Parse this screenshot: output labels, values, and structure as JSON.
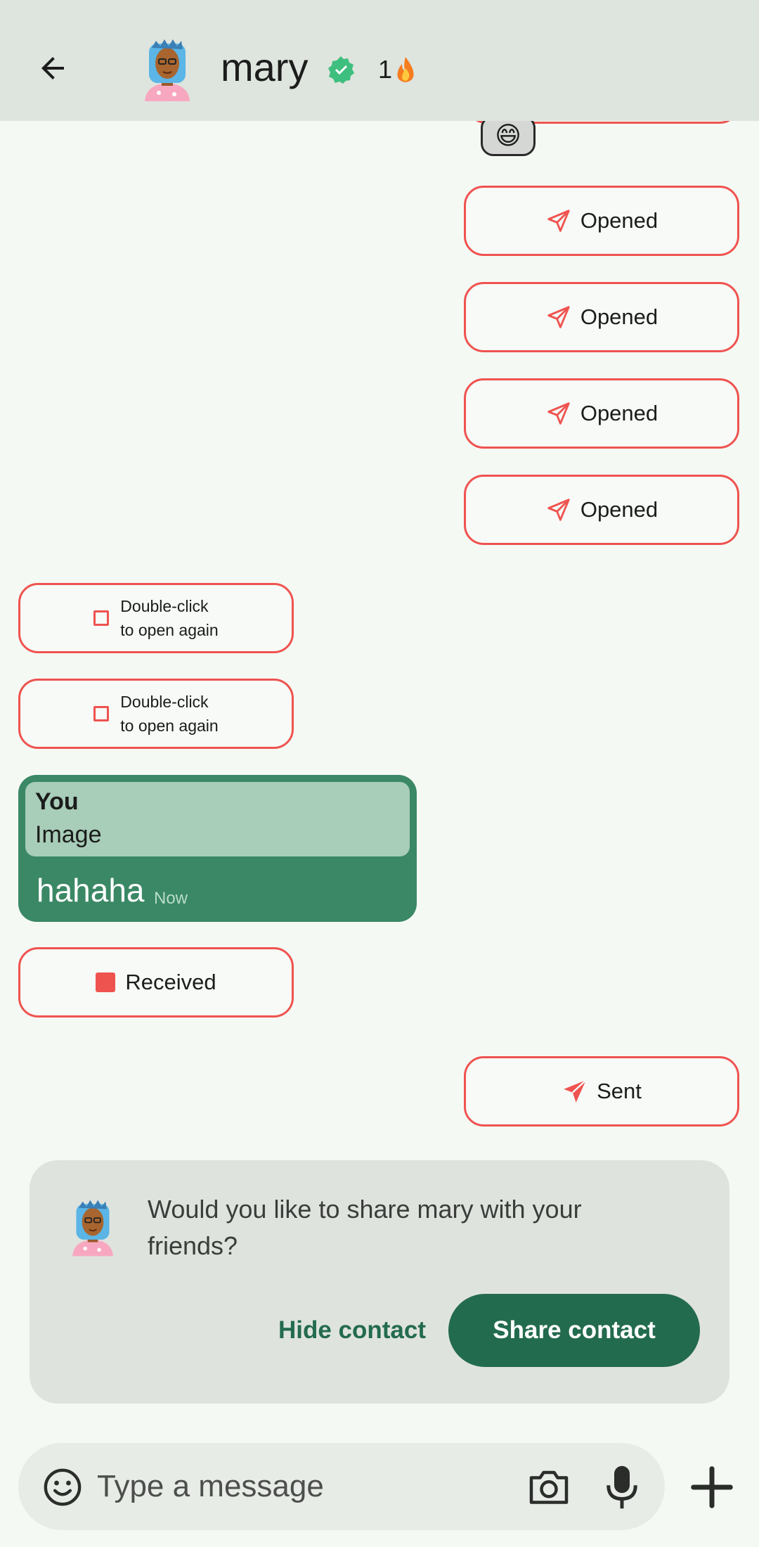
{
  "header": {
    "contact_name": "mary",
    "streak_count": "1",
    "icons": [
      "back-arrow-icon",
      "avatar",
      "verified-badge-icon",
      "fire-icon"
    ]
  },
  "chat": {
    "reaction_emoji": "😄",
    "sent_opened": [
      {
        "status": "Opened"
      },
      {
        "status": "Opened"
      },
      {
        "status": "Opened"
      },
      {
        "status": "Opened"
      }
    ],
    "received_replay": [
      {
        "line1": "Double-click",
        "line2": "to open again"
      },
      {
        "line1": "Double-click",
        "line2": "to open again"
      }
    ],
    "text_message": {
      "quote_author": "You",
      "quote_text": "Image",
      "text": "hahaha",
      "time": "Now"
    },
    "received_status": "Received",
    "sent_status": "Sent"
  },
  "share_card": {
    "prompt": "Would you like to share mary with your friends?",
    "hide_label": "Hide contact",
    "share_label": "Share contact"
  },
  "input": {
    "placeholder": "Type a message",
    "icons": [
      "emoji-icon",
      "camera-icon",
      "mic-icon",
      "plus-icon"
    ]
  },
  "colors": {
    "snap_red": "#ef5350",
    "accent_green": "#236b4e",
    "message_green": "#3a8865",
    "header_bg": "#dee4de"
  }
}
